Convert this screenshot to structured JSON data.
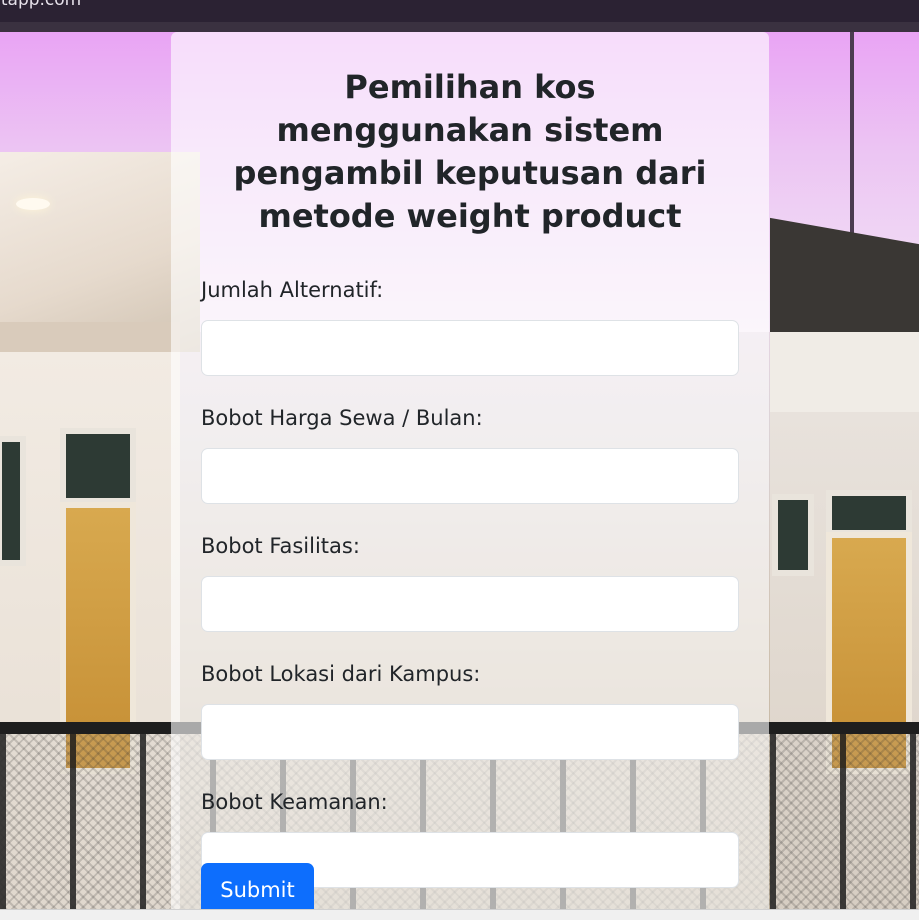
{
  "browser": {
    "url_fragment": "stapp.com"
  },
  "form": {
    "title": "Pemilihan kos menggunakan sistem pengambil keputusan dari metode weight product",
    "fields": [
      {
        "label": "Jumlah Alternatif:",
        "value": ""
      },
      {
        "label": "Bobot Harga Sewa / Bulan:",
        "value": ""
      },
      {
        "label": "Bobot Fasilitas:",
        "value": ""
      },
      {
        "label": "Bobot Lokasi dari Kampus:",
        "value": ""
      },
      {
        "label": "Bobot Keamanan:",
        "value": ""
      }
    ],
    "submit_label": "Submit"
  },
  "colors": {
    "accent": "#0d6efd",
    "text": "#212529"
  }
}
